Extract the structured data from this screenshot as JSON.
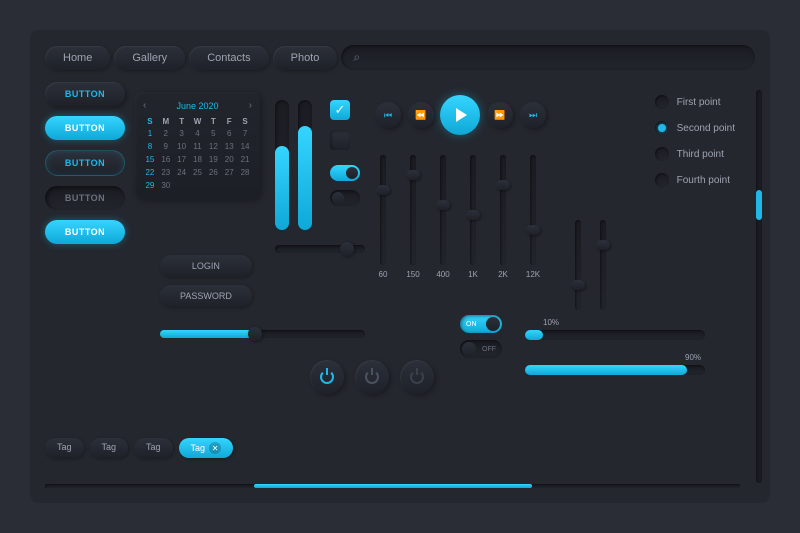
{
  "nav": {
    "items": [
      "Home",
      "Gallery",
      "Contacts",
      "Photo"
    ]
  },
  "buttons": {
    "label": "BUTTON"
  },
  "tags": {
    "label": "Tag"
  },
  "calendar": {
    "month": "June 2020",
    "dow": [
      "S",
      "M",
      "T",
      "W",
      "T",
      "F",
      "S"
    ],
    "days": [
      1,
      2,
      3,
      4,
      5,
      6,
      7,
      8,
      9,
      10,
      11,
      12,
      13,
      14,
      15,
      16,
      17,
      18,
      19,
      20,
      21,
      22,
      23,
      24,
      25,
      26,
      27,
      28,
      29,
      30
    ]
  },
  "auth": {
    "login": "LOGIN",
    "password": "PASSWORD"
  },
  "eq": {
    "labels": [
      "60",
      "150",
      "400",
      "1K",
      "2K",
      "12K"
    ]
  },
  "radio": {
    "items": [
      "First point",
      "Second point",
      "Third point",
      "Fourth point"
    ],
    "selected": 1
  },
  "switch": {
    "on": "ON",
    "off": "OFF"
  },
  "progress": {
    "p1": "10%",
    "p2": "90%"
  },
  "colors": {
    "accent": "#1fb8e8"
  }
}
